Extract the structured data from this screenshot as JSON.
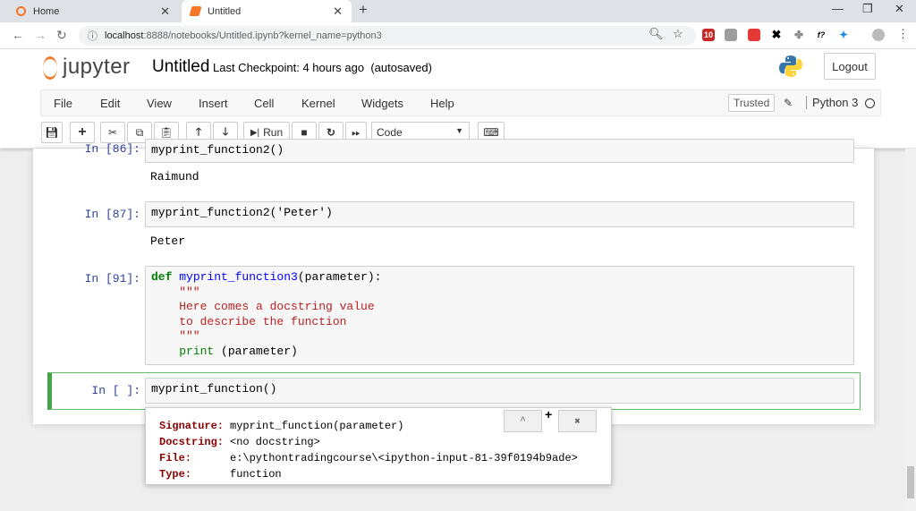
{
  "browser": {
    "tabs": [
      {
        "title": "Home",
        "active": false
      },
      {
        "title": "Untitled",
        "active": true
      }
    ],
    "url_host": "localhost",
    "url_path": ":8888/notebooks/Untitled.ipynb?kernel_name=python3",
    "extension_badge": "10"
  },
  "header": {
    "logo_text": "jupyter",
    "notebook_title": "Untitled",
    "checkpoint_text": "Last Checkpoint: 4 hours ago",
    "autosave_text": "(autosaved)",
    "logout_label": "Logout"
  },
  "menubar": {
    "items": [
      "File",
      "Edit",
      "View",
      "Insert",
      "Cell",
      "Kernel",
      "Widgets",
      "Help"
    ],
    "trusted_label": "Trusted",
    "kernel_name": "Python 3"
  },
  "toolbar": {
    "run_label": "Run",
    "cell_type": "Code"
  },
  "cells": [
    {
      "prompt": "In [86]:",
      "code": "myprint_function2()",
      "output": "Raimund"
    },
    {
      "prompt": "In [87]:",
      "code": "myprint_function2('Peter')",
      "output": "Peter"
    },
    {
      "prompt": "In [91]:"
    },
    {
      "prompt": "In [ ]:",
      "code": "myprint_function()"
    }
  ],
  "cell91": {
    "kw": "def",
    "fname": "myprint_function3",
    "params": "(parameter):",
    "doc_open": "    \"\"\"",
    "doc_line1": "    Here comes a docstring value",
    "doc_line2": "    to describe the function",
    "doc_close": "    \"\"\"",
    "print_kw": "    print",
    "print_args": " (parameter)"
  },
  "tooltip": {
    "signature_key": "Signature:",
    "signature_val": "myprint_function(parameter)",
    "docstring_key": "Docstring:",
    "docstring_val": "<no docstring>",
    "file_key": "File:",
    "file_val": "e:\\pythontradingcourse\\<ipython-input-81-39f0194b9ade>",
    "type_key": "Type:",
    "type_val": "function",
    "expand_glyph": "^",
    "plus_glyph": "+",
    "close_glyph": "✖"
  }
}
